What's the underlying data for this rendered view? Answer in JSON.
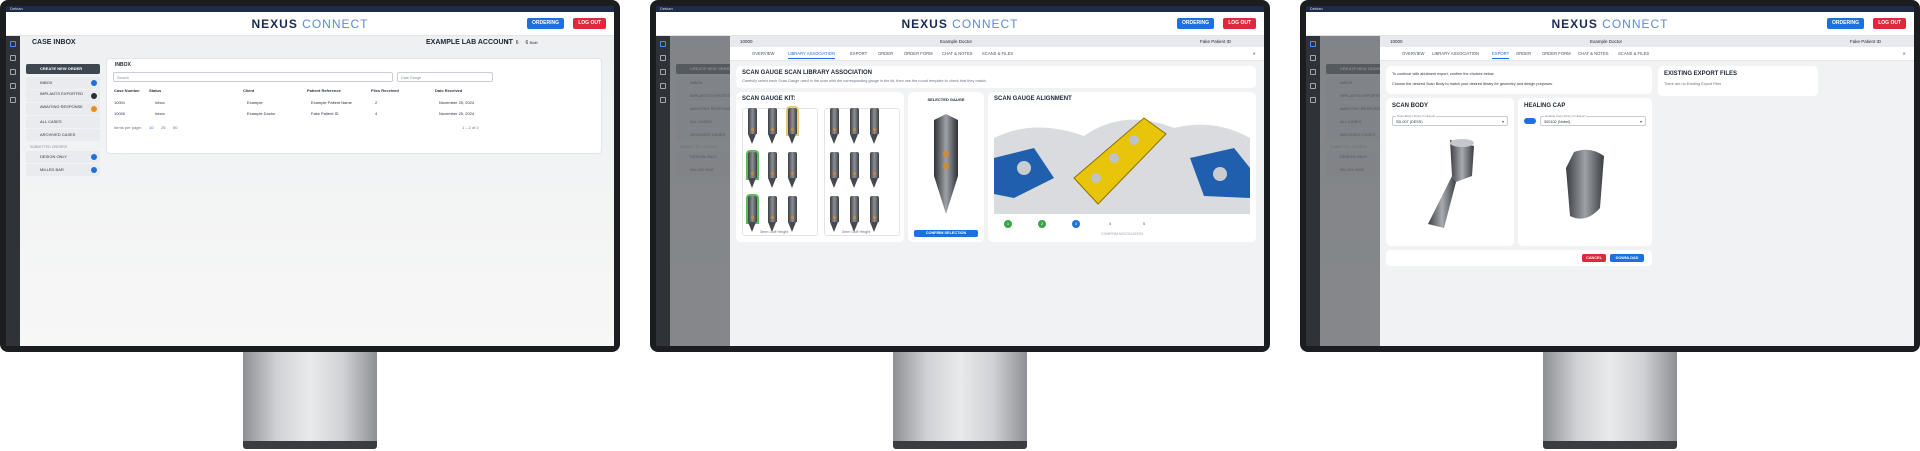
{
  "os": {
    "label": "Debian"
  },
  "brand": {
    "name": "NEXUS",
    "suffix": "CONNECT"
  },
  "header": {
    "ordering": "ORDERING",
    "logout": "LOG OUT"
  },
  "screen1": {
    "title": "CASE INBOX",
    "account": "EXAMPLE LAB ACCOUNT",
    "account_counts": [
      "6",
      "6",
      "6"
    ],
    "account_user": "Bluth",
    "sidebar": {
      "create": "CREATE NEW ORDER",
      "items": [
        {
          "label": "INBOX",
          "dot": "#1e6fe0"
        },
        {
          "label": "IMPLANTS EXPORTED",
          "dot": "#2a2f36"
        },
        {
          "label": "AWAITING RESPONSE",
          "dot": "#f08a1c"
        },
        {
          "label": "ALL CASES",
          "dot": ""
        },
        {
          "label": "ARCHIVED CASES",
          "dot": ""
        }
      ],
      "section": "SUBMITTED ORDERS",
      "orders": [
        {
          "label": "DESIGN ONLY",
          "dot": "#1e6fe0"
        },
        {
          "label": "MILLED BAR",
          "dot": "#1e6fe0"
        }
      ]
    },
    "inbox": {
      "title": "INBOX",
      "search_placeholder": "Search",
      "date_placeholder": "Date Range",
      "columns": [
        "Case Number",
        "Status",
        "Client",
        "Patient Reference",
        "Files Received",
        "Date Received"
      ],
      "rows": [
        [
          "10001",
          "Inbox",
          "Example",
          "Example Patient Name",
          "2",
          "November 25, 2024"
        ],
        [
          "10000",
          "Inbox",
          "Example Doctor",
          "Fake Patient ID",
          "4",
          "November 25, 2024"
        ]
      ],
      "items_per_page": "Items per page:",
      "page_sizes": [
        "10",
        "25",
        "50"
      ],
      "range": "1 – 2 of 2"
    }
  },
  "modal": {
    "case_number": "10000",
    "doctor": "Example Doctor",
    "patient": "Fake Patient ID",
    "tabs": [
      "OVERVIEW",
      "LIBRARY ASSOCIATION",
      "EXPORT",
      "ORDER",
      "ORDER FORM",
      "CHAT & NOTES",
      "SCANS & FILES"
    ],
    "side_labels": [
      "CREATE NEW ORDER",
      "INBOX",
      "IMPLANTS EXPORTED",
      "AWAITING RESPONSE",
      "ALL CASES",
      "ARCHIVED CASES",
      "SUBMITTED ORDERS",
      "DESIGN ONLY",
      "MILLED BAR"
    ]
  },
  "screen2": {
    "title": "SCAN GAUGE SCAN LIBRARY ASSOCIATION",
    "subtitle": "Carefully select each Scan Gauge used in the scan with the corresponding gauge in the kit, then use the round template to check that they match.",
    "kit_title": "SCAN GAUGE KIT:",
    "kit_left_label": "3mm Cuff Height",
    "kit_right_label": "3mm Cuff Height",
    "selected_title": "SELECTED GAUGE",
    "confirm": "CONFIRM SELECTION",
    "align_title": "SCAN GAUGE ALIGNMENT",
    "steps": [
      "1",
      "2",
      "3",
      "4",
      "5"
    ],
    "confirm_assoc": "CONFIRM ASSOCIATION"
  },
  "screen3": {
    "intro": "To continue with abutment export, confirm the choices below.",
    "intro2": "Choose the desired Scan Body to match your desired library for geometry and design purposes.",
    "scan_body_title": "SCAN BODY",
    "scan_body_label": "Scan Body Library for Export",
    "scan_body_value": "SD.007 (DESS)",
    "healing_title": "HEALING CAP",
    "healing_label": "Healing Cap Library for Export",
    "healing_value": "300102 (Nobel)",
    "cancel": "CANCEL",
    "download": "DOWNLOAD",
    "existing_title": "EXISTING EXPORT FILES",
    "existing_text": "There are no Existing Export Files"
  }
}
